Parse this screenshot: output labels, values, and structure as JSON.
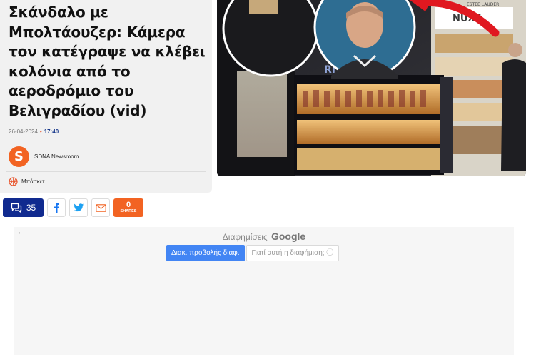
{
  "article": {
    "headline": "Σκάνδαλο με Μπολτάουζερ: Κάμερα τον κατέγραψε να κλέβει κολόνια από το αεροδρόμιο του Βελιγραδίου (vid)",
    "date": "26-04-2024",
    "separator": "•",
    "time": "17:40",
    "author_initial": "S",
    "author": "SDNA Newsroom",
    "category": "Μπάσκετ"
  },
  "hero_image": {
    "sign_text": "ESTEE LAUDER",
    "brand_text": "NUXE",
    "shelf_text": "RISTLES"
  },
  "share": {
    "comments_count": "35",
    "shares_count": "0",
    "shares_label": "SHARES"
  },
  "ads": {
    "back_glyph": "←",
    "label": "Διαφημίσεις",
    "brand": "Google",
    "primary_button": "Διακ. προβολής διαφ.",
    "secondary_button": "Γιατί αυτή η διαφήμιση; ⓘ"
  },
  "colors": {
    "accent_orange": "#f26322",
    "accent_navy": "#102a8f",
    "google_blue": "#4285f4"
  }
}
